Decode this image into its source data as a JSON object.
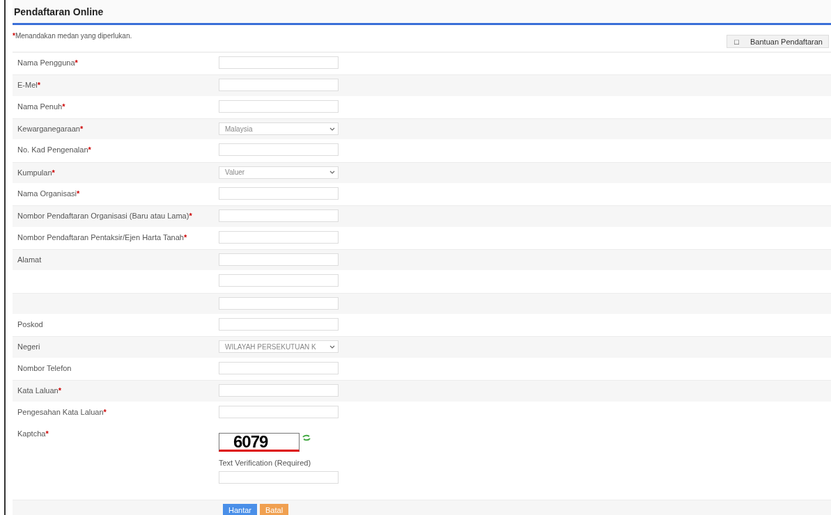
{
  "title": "Pendaftaran Online",
  "note_mark": "*",
  "note": "Menandakan medan yang diperlukan.",
  "help_button": {
    "icon": "□",
    "label": "Bantuan Pendaftaran"
  },
  "fields": [
    {
      "label": "Nama Pengguna",
      "mark": "*",
      "kind": "text"
    },
    {
      "label": "E-Mel",
      "mark": "*",
      "kind": "text"
    },
    {
      "label": "Nama Penuh",
      "mark": "*",
      "kind": "text"
    },
    {
      "label": "Kewarganegaraan",
      "mark": "*",
      "kind": "select",
      "value": "Malaysia"
    },
    {
      "label": "No. Kad Pengenalan",
      "mark": "*",
      "kind": "text"
    },
    {
      "label": "Kumpulan",
      "mark": "*",
      "kind": "select",
      "value": "Valuer"
    },
    {
      "label": "Nama Organisasi",
      "mark": "*",
      "kind": "text"
    },
    {
      "label": "Nombor Pendaftaran Organisasi (Baru atau Lama)",
      "mark": "*",
      "kind": "text"
    },
    {
      "label": "Nombor Pendaftaran Pentaksir/Ejen Harta Tanah",
      "mark": "*",
      "kind": "text"
    },
    {
      "label": "Alamat",
      "kind": "text"
    },
    {
      "kind": "text"
    },
    {
      "kind": "text"
    },
    {
      "label": "Poskod",
      "kind": "text"
    },
    {
      "label": "Negeri",
      "kind": "select",
      "value": "WILAYAH PERSEKUTUAN K"
    },
    {
      "label": "Nombor Telefon",
      "kind": "text"
    },
    {
      "label": "Kata Laluan",
      "mark": "*",
      "kind": "text"
    },
    {
      "label": "Pengesahan Kata Laluan",
      "mark": "*",
      "kind": "text"
    },
    {
      "label": "Kaptcha",
      "mark": "*",
      "kind": "captcha",
      "code": "6079",
      "caption": "Text Verification (Required)"
    }
  ],
  "buttons": [
    {
      "label": "Hantar",
      "kind": "primary"
    },
    {
      "label": "Batal",
      "kind": "cancel"
    }
  ]
}
